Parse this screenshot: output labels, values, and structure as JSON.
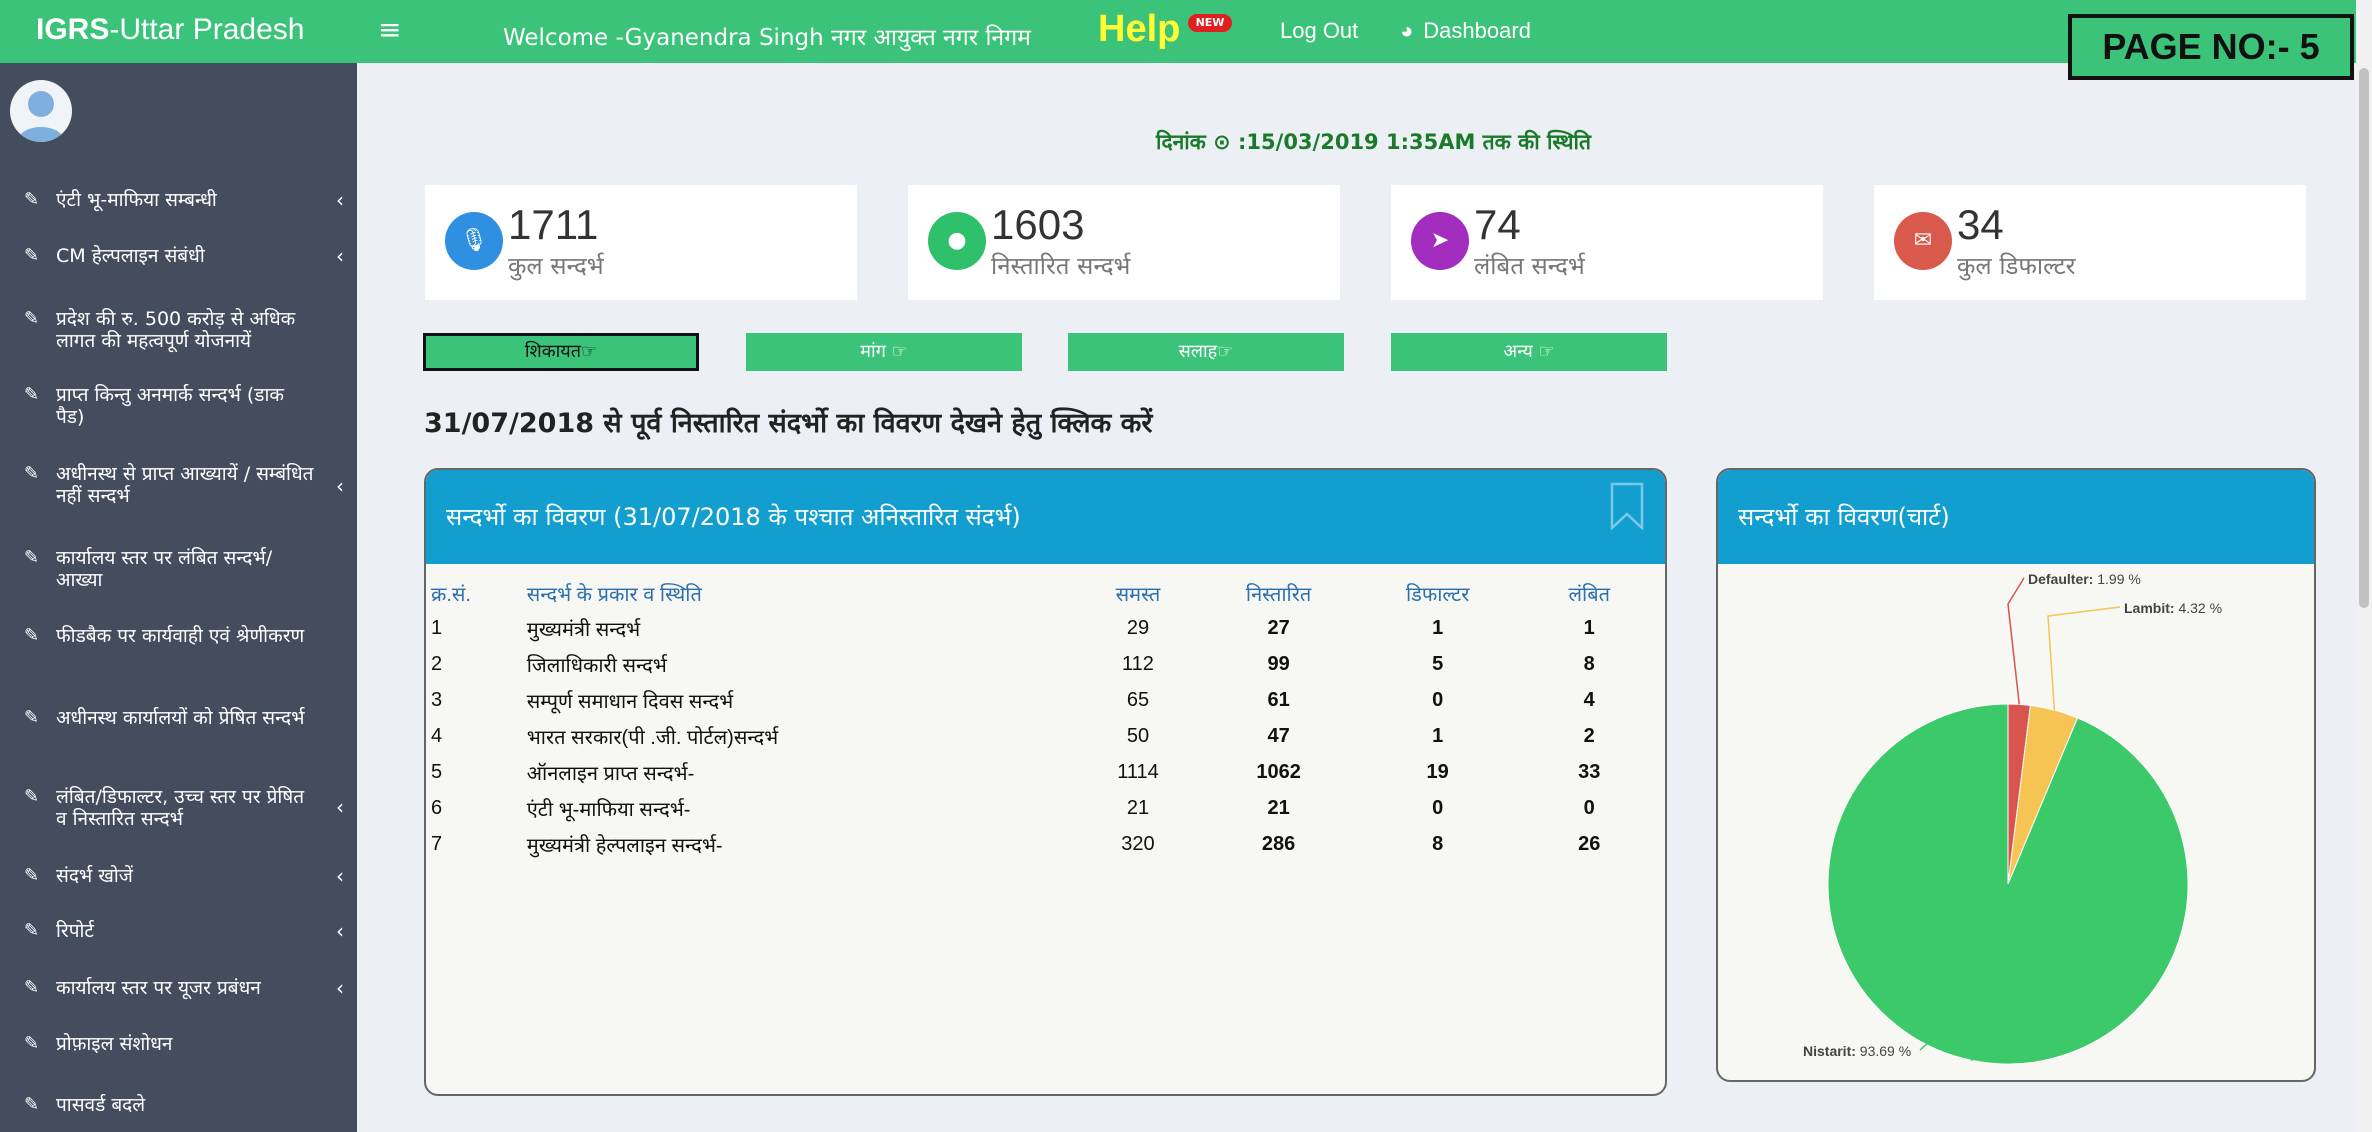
{
  "header": {
    "brand_bold": "IGRS",
    "brand_rest": "-Uttar Pradesh",
    "menu_icon": "hamburger-icon",
    "welcome": "Welcome -Gyanendra Singh नगर आयुक्त नगर निगम",
    "help": "Help",
    "help_badge": "NEW",
    "logout": "Log Out",
    "dashboard": "Dashboard",
    "page_no": "PAGE NO:- 5"
  },
  "sidebar": {
    "items": [
      {
        "label": "एंटी भू-माफिया सम्बन्धी",
        "chevron": "‹"
      },
      {
        "label": "CM हेल्पलाइन संबंधी",
        "chevron": "‹"
      },
      {
        "label": "प्रदेश की रु. 500 करोड़ से अधिक लागत की महत्वपूर्ण योजनायें",
        "chevron": ""
      },
      {
        "label": "प्राप्त किन्तु अनमार्क सन्दर्भ (डाक पैड)",
        "chevron": ""
      },
      {
        "label": "अधीनस्थ से प्राप्त आख्यायें / सम्बंधित नहीं सन्दर्भ",
        "chevron": "‹"
      },
      {
        "label": "कार्यालय स्तर पर लंबित सन्दर्भ/ आख्या",
        "chevron": ""
      },
      {
        "label": "फीडबैक पर कार्यवाही एवं श्रेणीकरण",
        "chevron": ""
      },
      {
        "label": "अधीनस्थ कार्यालयों को प्रेषित सन्दर्भ",
        "chevron": ""
      },
      {
        "label": "लंबित/डिफाल्टर, उच्च स्तर पर प्रेषित व निस्तारित सन्दर्भ",
        "chevron": "‹"
      },
      {
        "label": "संदर्भ खोजें",
        "chevron": "‹"
      },
      {
        "label": "रिपोर्ट",
        "chevron": "‹"
      },
      {
        "label": "कार्यालय स्तर पर यूजर प्रबंधन",
        "chevron": "‹"
      },
      {
        "label": "प्रोफ़ाइल संशोधन",
        "chevron": ""
      },
      {
        "label": "पासवर्ड बदले",
        "chevron": ""
      }
    ]
  },
  "status": "दिनांक ⊙ :15/03/2019 1:35AM तक की स्थिति",
  "stats": [
    {
      "value": "1711",
      "label": "कुल सन्दर्भ",
      "color": "#2f8fe0",
      "icon": "microphone-icon"
    },
    {
      "value": "1603",
      "label": "निस्तारित सन्दर्भ",
      "color": "#2ec06a",
      "icon": "drop-icon"
    },
    {
      "value": "74",
      "label": "लंबित सन्दर्भ",
      "color": "#a32dbf",
      "icon": "paper-plane-icon"
    },
    {
      "value": "34",
      "label": "कुल डिफाल्टर",
      "color": "#d9594c",
      "icon": "envelope-icon"
    }
  ],
  "tabs": [
    "शिकायत☞",
    "मांग ☞",
    "सलाह☞",
    "अन्य ☞"
  ],
  "prior_link": "31/07/2018  से पूर्व निस्तारित संदर्भो का विवरण देखने हेतु क्लिक करें",
  "table": {
    "title": "सन्दर्भो का विवरण (31/07/2018  के पश्चात अनिस्तारित संदर्भ)",
    "columns": [
      "क्र.सं.",
      "सन्दर्भ के प्रकार व स्थिति",
      "समस्त",
      "निस्तारित",
      "डिफाल्टर",
      "लंबित"
    ],
    "rows": [
      [
        "1",
        "मुख्यमंत्री सन्दर्भ",
        "29",
        "27",
        "1",
        "1"
      ],
      [
        "2",
        "जिलाधिकारी सन्दर्भ",
        "112",
        "99",
        "5",
        "8"
      ],
      [
        "3",
        "सम्पूर्ण समाधान दिवस सन्दर्भ",
        "65",
        "61",
        "0",
        "4"
      ],
      [
        "4",
        "भारत सरकार(पी .जी. पोर्टल)सन्दर्भ",
        "50",
        "47",
        "1",
        "2"
      ],
      [
        "5",
        "ऑनलाइन प्राप्त सन्दर्भ-",
        "1114",
        "1062",
        "19",
        "33"
      ],
      [
        "6",
        "एंटी भू-माफिया सन्दर्भ-",
        "21",
        "21",
        "0",
        "0"
      ],
      [
        "7",
        "मुख्यमंत्री हेल्पलाइन सन्दर्भ-",
        "320",
        "286",
        "8",
        "26"
      ]
    ]
  },
  "chart_panel_title": "सन्दर्भो का विवरण(चार्ट)",
  "chart_data": {
    "type": "pie",
    "labels": [
      "Defaulter",
      "Lambit",
      "Nistarit"
    ],
    "values": [
      1.99,
      4.32,
      93.69
    ],
    "data_labels": [
      "Defaulter: 1.99 %",
      "Lambit: 4.32 %",
      "Nistarit: 93.69 %"
    ],
    "colors": [
      "#d9534f",
      "#f6c453",
      "#3cc96a"
    ]
  }
}
